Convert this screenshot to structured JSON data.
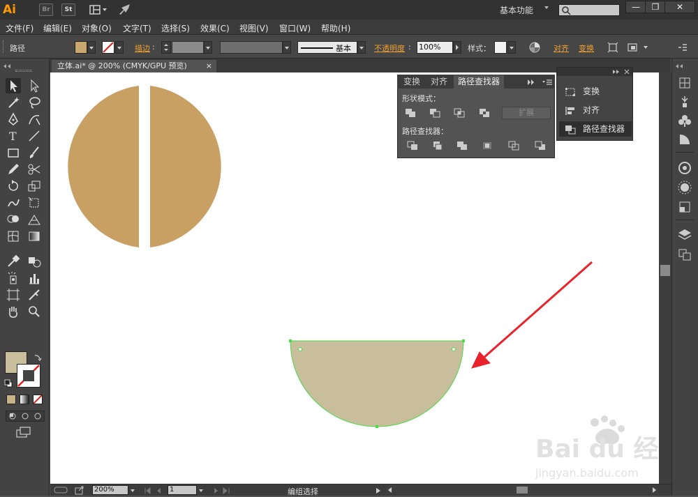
{
  "app": {
    "logo": "Ai",
    "bridge": "Br",
    "stock": "St",
    "workspace": "基本功能",
    "window_buttons": [
      "—",
      "❐",
      "✕"
    ]
  },
  "menu": [
    "文件(F)",
    "编辑(E)",
    "对象(O)",
    "文字(T)",
    "选择(S)",
    "效果(C)",
    "视图(V)",
    "窗口(W)",
    "帮助(H)"
  ],
  "control_bar": {
    "selection_type": "路径",
    "fill_color": "#c9a870",
    "stroke_label": "描边",
    "stroke_colon": ":",
    "brush_label": "基本",
    "opacity_label": "不透明度",
    "opacity_colon": ":",
    "opacity_value": "100%",
    "style_label": "样式：",
    "align_link": "对齐",
    "transform_link": "变换"
  },
  "document": {
    "tab_title": "立体.ai* @ 200% (CMYK/GPU 预览)",
    "tab_close": "×",
    "zoom": "200%",
    "artboard": "1",
    "status": "编组选择"
  },
  "canvas": {
    "circle_fill": "#c8a064",
    "selected_fill": "#c8be9c",
    "selection_color": "#4cd94c",
    "arrow_color": "#e8232b",
    "watermark_text": "Bai du 经验",
    "watermark_url": "jingyan.baidu.com"
  },
  "pathfinder_panel": {
    "tabs": [
      "变换",
      "对齐",
      "路径查找器"
    ],
    "active_tab": "路径查找器",
    "shape_modes_label": "形状模式：",
    "expand_button": "扩展",
    "pathfinders_label": "路径查找器："
  },
  "collapsed_dock": {
    "items": [
      "变换",
      "对齐",
      "路径查找器"
    ],
    "active_item": "路径查找器"
  },
  "icons": {
    "toolbar": [
      "selection-tool-icon",
      "direct-selection-tool-icon",
      "magic-wand-icon",
      "lasso-icon",
      "pen-tool-icon",
      "curvature-tool-icon",
      "type-tool-icon",
      "line-tool-icon",
      "rectangle-tool-icon",
      "paintbrush-icon",
      "pencil-icon",
      "scissors-icon",
      "rotate-tool-icon",
      "scale-tool-icon",
      "warp-tool-icon",
      "free-transform-icon",
      "shape-builder-icon",
      "perspective-grid-icon",
      "mesh-tool-icon",
      "gradient-tool-icon",
      "eyedropper-icon",
      "blend-tool-icon",
      "symbol-sprayer-icon",
      "column-graph-icon",
      "artboard-tool-icon",
      "slice-tool-icon",
      "hand-tool-icon",
      "zoom-tool-icon"
    ]
  }
}
